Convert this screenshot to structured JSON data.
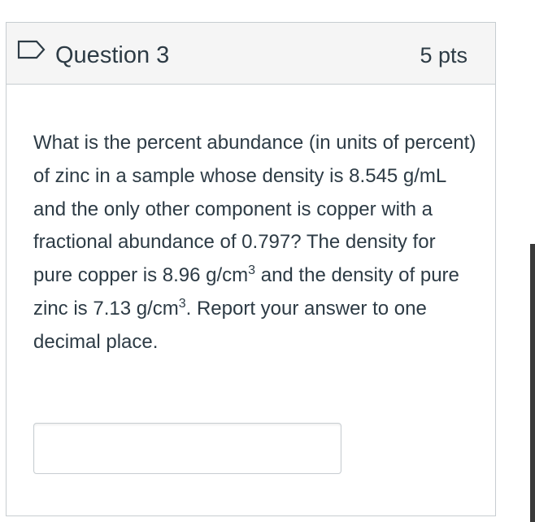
{
  "question": {
    "title": "Question 3",
    "points": "5 pts",
    "flag_icon": "flag-outline-icon",
    "text_parts": {
      "p1": "What is the percent abundance (in units of percent) of zinc in a sample whose density is 8.545 g/mL and the only other component is copper with a fractional abundance of 0.797? The density for pure copper is 8.96 g/cm",
      "sup1": "3",
      "p2": " and the density of pure zinc is 7.13 g/cm",
      "sup2": "3",
      "p3": ". Report your answer to one decimal place."
    },
    "answer": {
      "value": "",
      "placeholder": ""
    }
  },
  "colors": {
    "header_bg": "#f5f5f5",
    "border": "#c7cdd1",
    "text": "#2d3b45",
    "flag_stroke": "#2d3b45"
  }
}
